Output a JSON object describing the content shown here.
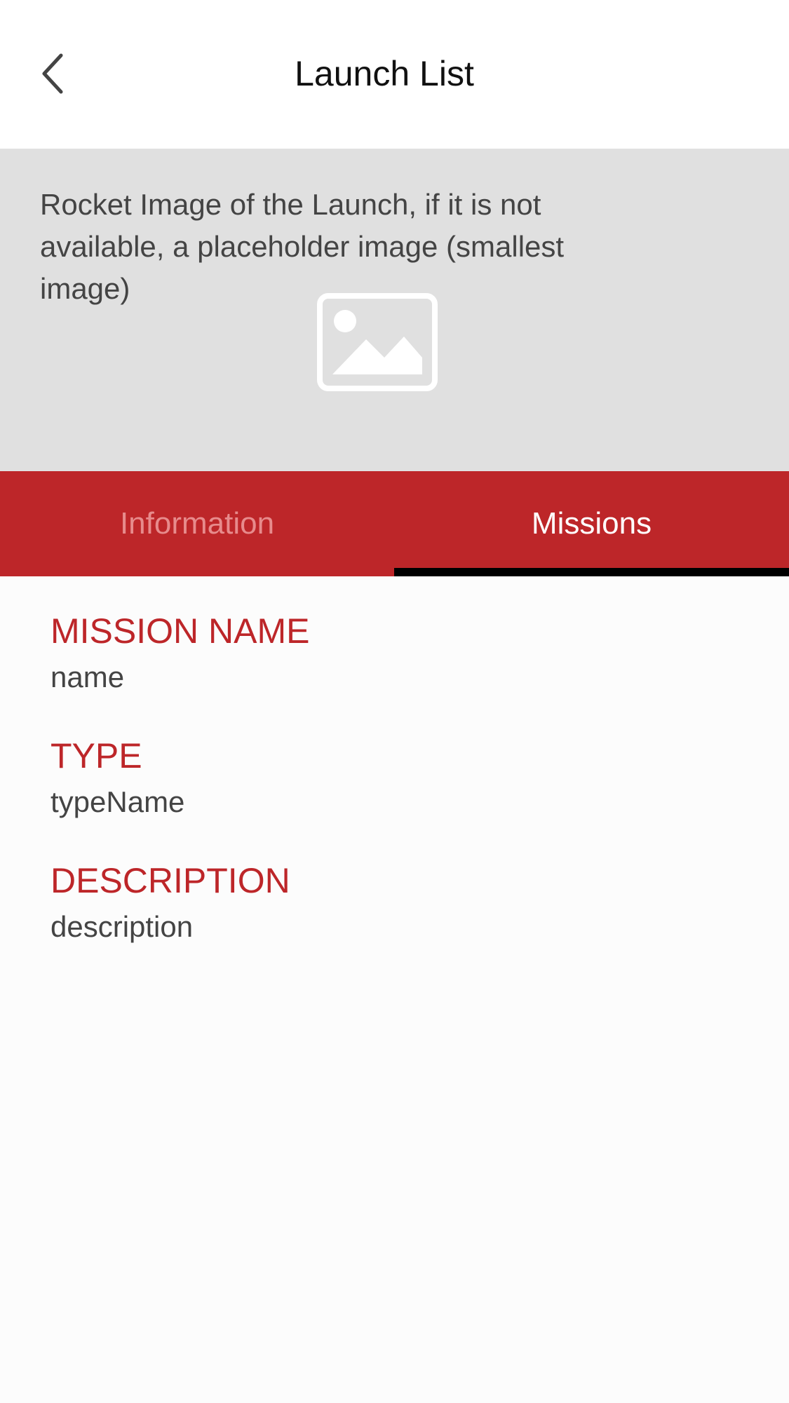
{
  "navbar": {
    "title": "Launch List",
    "back_icon": "chevron-left-icon"
  },
  "hero": {
    "caption": "Rocket Image of the Launch, if it is not available, a placeholder image (smallest image)",
    "placeholder_icon": "image-placeholder-icon",
    "background": "#e0e0e0"
  },
  "tabs": {
    "items": [
      {
        "label": "Information",
        "selected": false
      },
      {
        "label": "Missions",
        "selected": true
      }
    ],
    "background": "#bd2629",
    "indicator_color": "#000000"
  },
  "mission": {
    "fields": [
      {
        "label": "MISSION NAME",
        "value": "name"
      },
      {
        "label": "TYPE",
        "value": "typeName"
      },
      {
        "label": "DESCRIPTION",
        "value": "description"
      }
    ],
    "label_color": "#bd2629"
  }
}
